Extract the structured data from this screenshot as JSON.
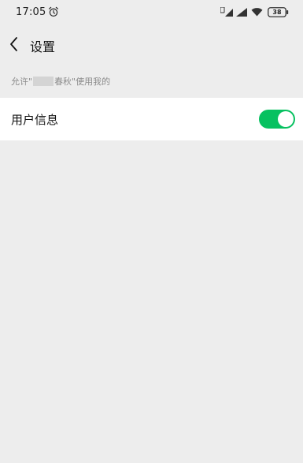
{
  "status_bar": {
    "time": "17:05",
    "icons": [
      "alarm-clock-icon",
      "sim1-signal-icon",
      "sim2-signal-icon",
      "wifi-icon",
      "battery-icon"
    ],
    "battery_level": "38"
  },
  "nav": {
    "back_icon": "chevron-left-icon",
    "title": "设置"
  },
  "section": {
    "header_prefix": "允许\"",
    "header_suffix": "春秋\"使用我的"
  },
  "settings": {
    "items": [
      {
        "label": "用户信息",
        "toggle_on": true
      }
    ]
  },
  "colors": {
    "background": "#ededed",
    "row_background": "#ffffff",
    "toggle_on": "#07c160",
    "secondary_text": "#8c8c8c"
  }
}
